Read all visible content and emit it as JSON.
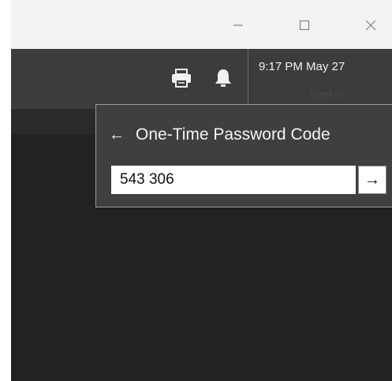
{
  "titlebar": {
    "minimize_icon": "minimize-icon",
    "maximize_icon": "maximize-icon",
    "close_icon": "close-icon"
  },
  "toolbar": {
    "printer_icon": "printer-icon",
    "bell_icon": "bell-icon"
  },
  "status": {
    "clock": "9:17 PM  May 27",
    "sign_in": "Sign in"
  },
  "otp": {
    "back_arrow": "←",
    "title": "One-Time Password Code",
    "value": "543 306",
    "submit_arrow": "→"
  },
  "colors": {
    "titlebar_bg": "#f3f3f3",
    "appbar_bg": "#3c3c3c",
    "content_bg": "#222222",
    "panel_bg": "#3f3f3f"
  }
}
